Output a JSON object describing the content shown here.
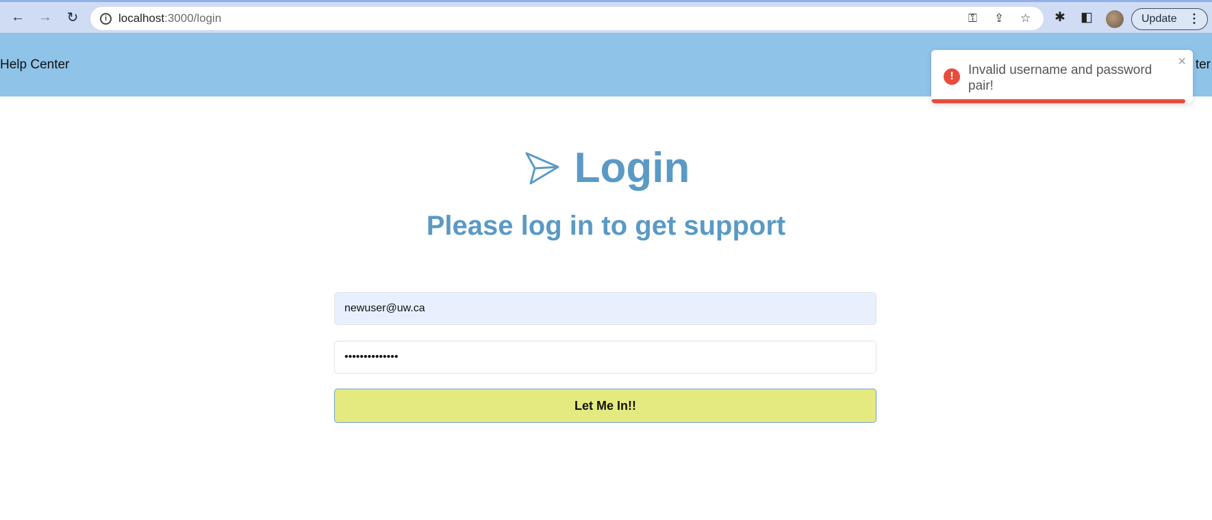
{
  "browser": {
    "url_host": "localhost",
    "url_path": ":3000/login",
    "update_label": "Update"
  },
  "header": {
    "brand": "Help Center",
    "right_partial": "ter"
  },
  "toast": {
    "message": "Invalid username and password pair!",
    "close": "×",
    "type": "error",
    "progress_percent": 97,
    "color": "#e74c3c"
  },
  "login": {
    "title": "Login",
    "subtitle": "Please log in to get support",
    "email_value": "newuser@uw.ca",
    "password_value": "••••••••••••••",
    "submit_label": "Let Me In!!"
  },
  "colors": {
    "header_bg": "#8fc3e8",
    "accent_text": "#5a9ac4",
    "button_bg": "#e4ea7f"
  }
}
